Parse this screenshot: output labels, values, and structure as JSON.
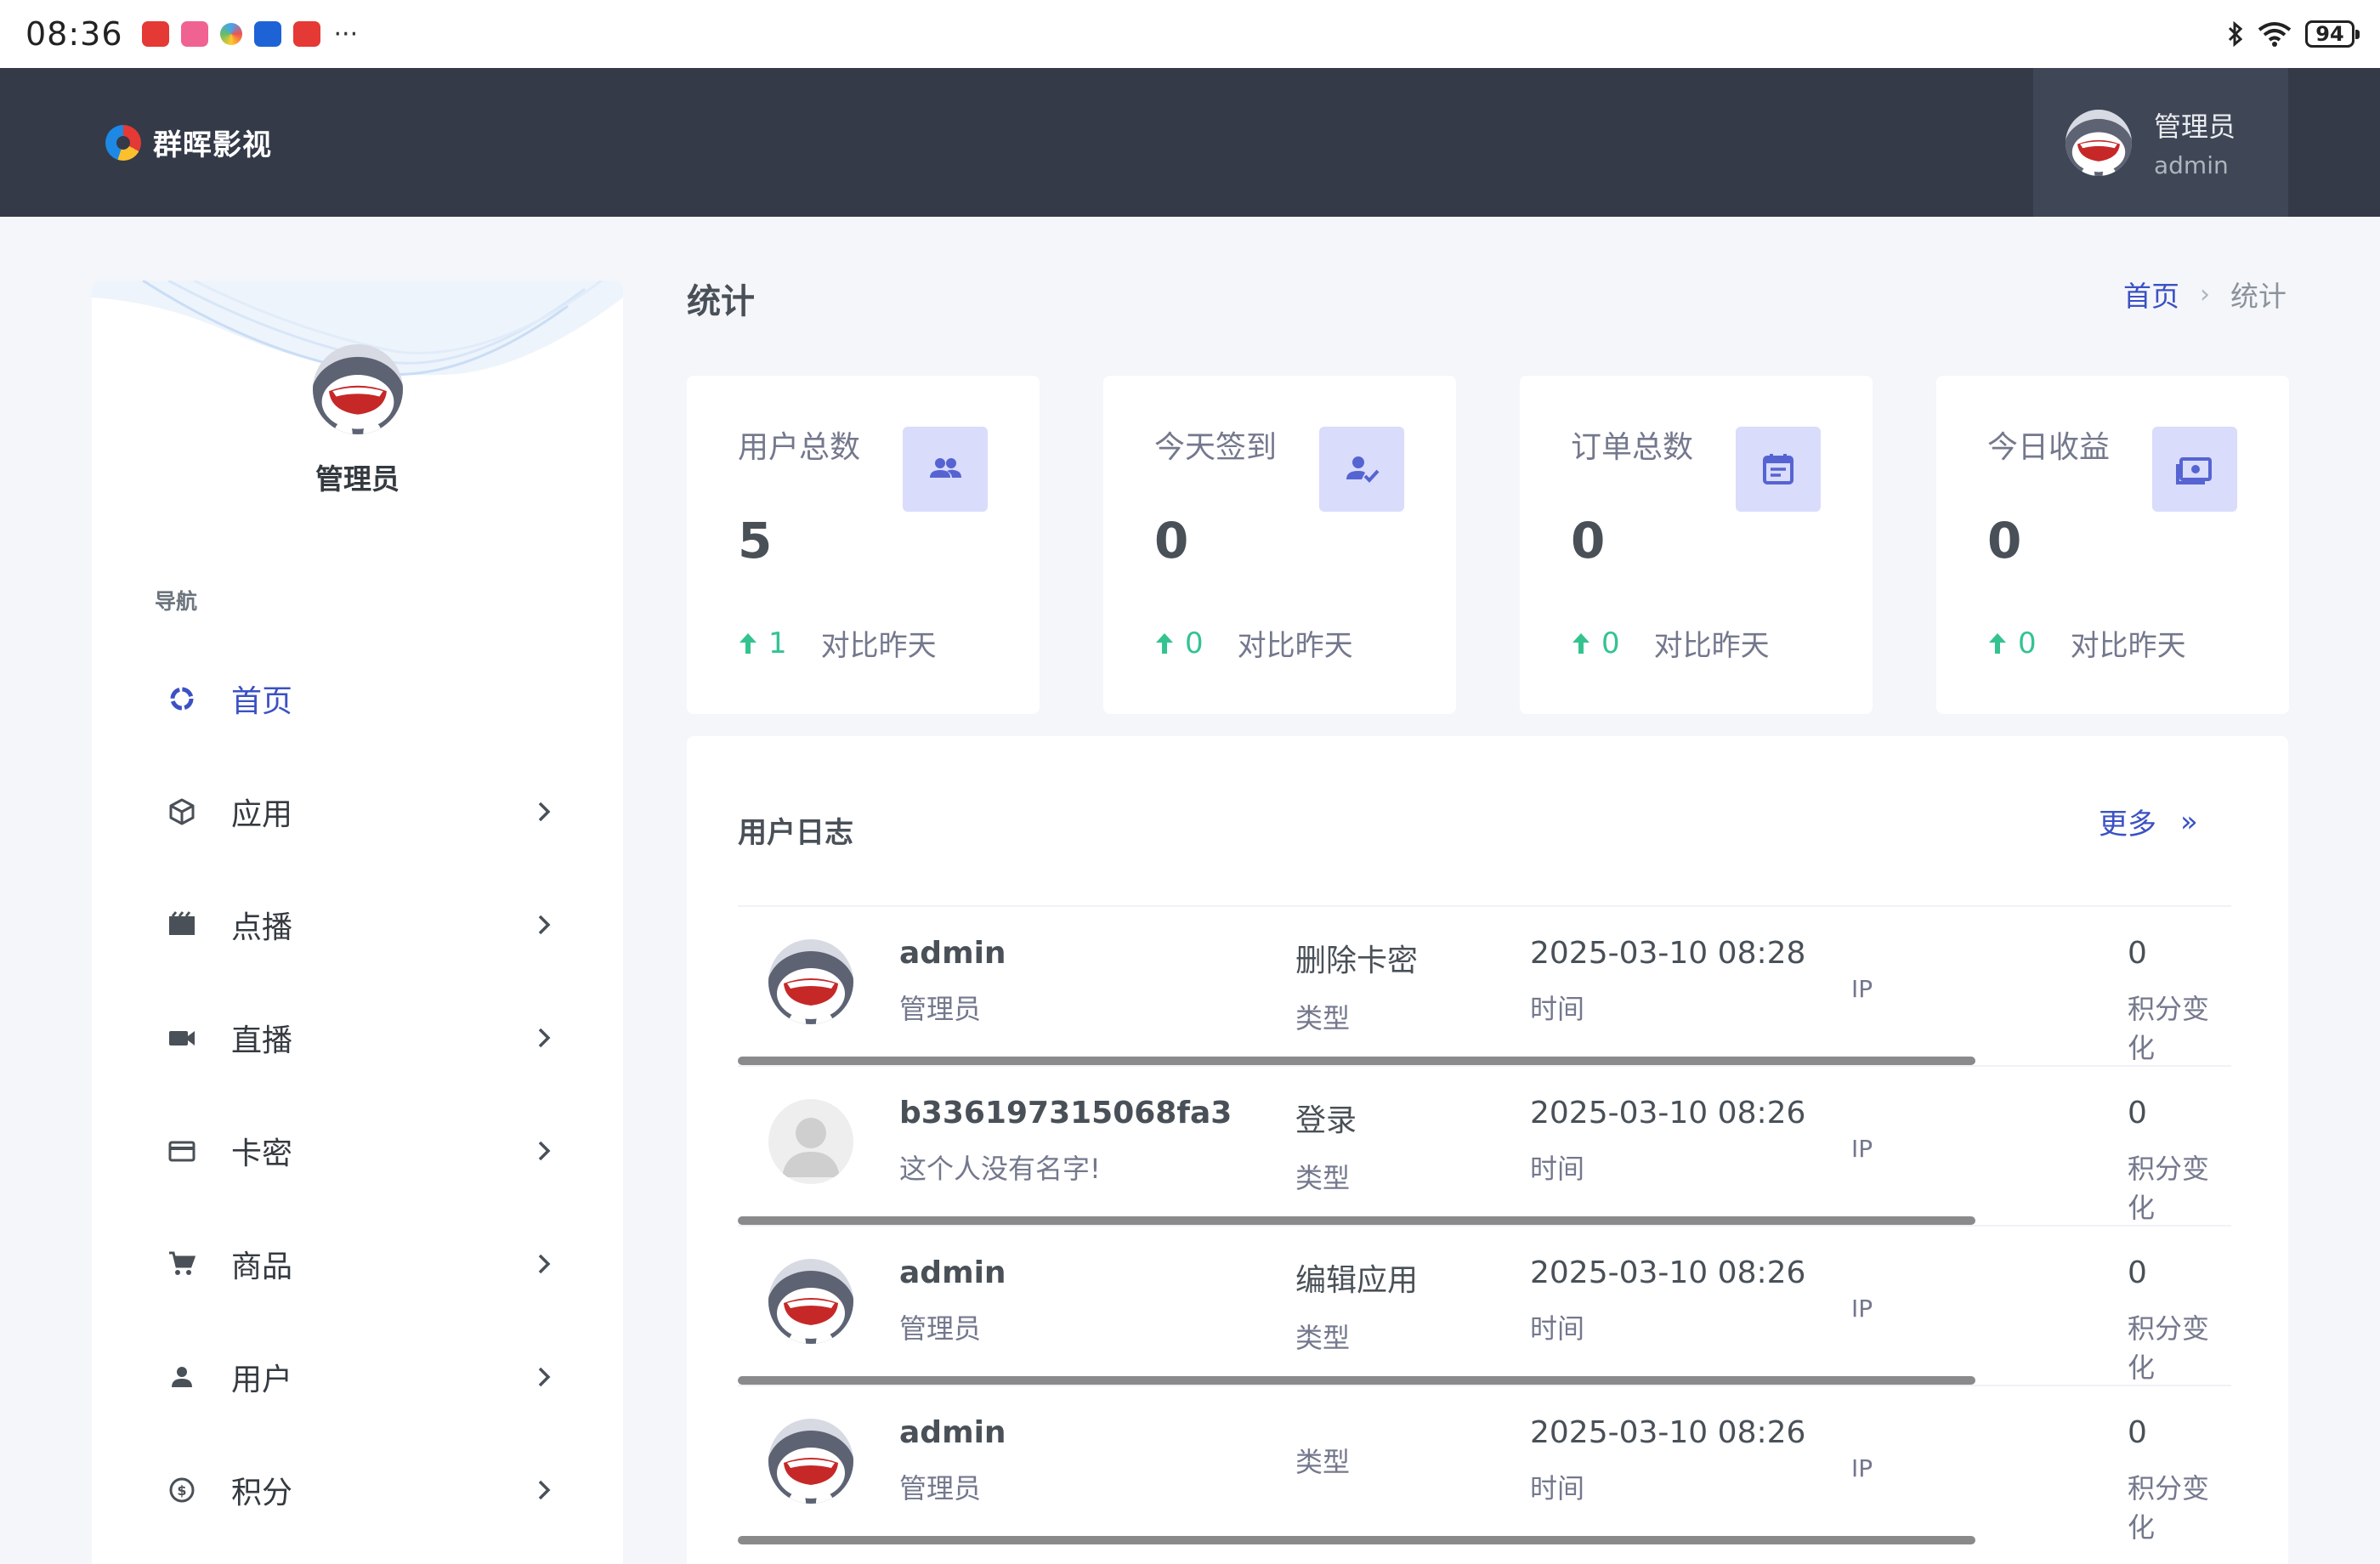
{
  "status_bar": {
    "time": "08:36",
    "more": "···",
    "battery": "94",
    "icons": [
      "app-icon-red",
      "app-icon-pink",
      "app-icon-multicolor",
      "app-icon-blue",
      "app-icon-red",
      "bluetooth-icon",
      "wifi-icon",
      "battery-icon"
    ]
  },
  "header": {
    "brand": "群晖影视",
    "user_name": "管理员",
    "user_role": "admin"
  },
  "sidebar": {
    "profile_name": "管理员",
    "nav_caption": "导航",
    "items": [
      {
        "label": "首页",
        "icon": "dashboard-icon",
        "active": true
      },
      {
        "label": "应用",
        "icon": "cube-icon"
      },
      {
        "label": "点播",
        "icon": "clapperboard-icon"
      },
      {
        "label": "直播",
        "icon": "video-camera-icon"
      },
      {
        "label": "卡密",
        "icon": "credit-card-icon"
      },
      {
        "label": "商品",
        "icon": "cart-icon"
      },
      {
        "label": "用户",
        "icon": "user-icon"
      },
      {
        "label": "积分",
        "icon": "coin-icon"
      }
    ]
  },
  "page": {
    "title": "统计",
    "breadcrumb": {
      "home": "首页",
      "separator": "›",
      "current": "统计"
    }
  },
  "stats": [
    {
      "title": "用户总数",
      "value": "5",
      "delta": "1",
      "compare": "对比昨天",
      "icon": "users-icon"
    },
    {
      "title": "今天签到",
      "value": "0",
      "delta": "0",
      "compare": "对比昨天",
      "icon": "user-check-icon"
    },
    {
      "title": "订单总数",
      "value": "0",
      "delta": "0",
      "compare": "对比昨天",
      "icon": "calendar-icon"
    },
    {
      "title": "今日收益",
      "value": "0",
      "delta": "0",
      "compare": "对比昨天",
      "icon": "cash-icon"
    }
  ],
  "log": {
    "title": "用户日志",
    "more": "更多",
    "more_icon": "»",
    "rows": [
      {
        "name": "admin",
        "role": "管理员",
        "action": "删除卡密",
        "type_label": "类型",
        "time": "2025-03-10 08:28",
        "time_label": "时间",
        "ip": "IP",
        "points": "0",
        "points_label": "积分变化",
        "avatar": "mascot"
      },
      {
        "name": "b336197315068fa3",
        "role": "这个人没有名字!",
        "action": "登录",
        "type_label": "类型",
        "time": "2025-03-10 08:26",
        "time_label": "时间",
        "ip": "IP",
        "points": "0",
        "points_label": "积分变化",
        "avatar": "default"
      },
      {
        "name": "admin",
        "role": "管理员",
        "action": "编辑应用",
        "type_label": "类型",
        "time": "2025-03-10 08:26",
        "time_label": "时间",
        "ip": "IP",
        "points": "0",
        "points_label": "积分变化",
        "avatar": "mascot"
      },
      {
        "name": "admin",
        "role": "管理员",
        "action": "",
        "type_label": "类型",
        "time": "2025-03-10 08:26",
        "time_label": "时间",
        "ip": "IP",
        "points": "0",
        "points_label": "积分变化",
        "avatar": "mascot"
      }
    ]
  },
  "colors": {
    "accent": "#3b51c4",
    "header_bg": "#343a48",
    "positive": "#34c38f",
    "icon_tile": "#d9dcfb"
  }
}
